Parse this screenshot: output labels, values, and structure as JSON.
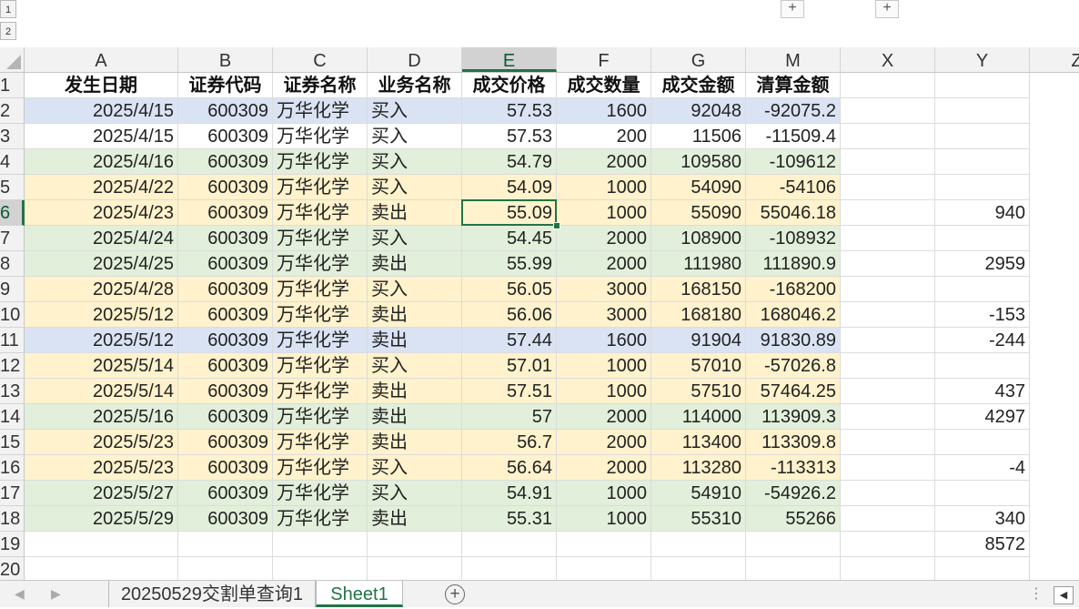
{
  "outline": {
    "levels": [
      "1",
      "2"
    ],
    "plus_symbol": "+"
  },
  "columns": [
    "A",
    "B",
    "C",
    "D",
    "E",
    "F",
    "G",
    "M",
    "X",
    "Y",
    "Z"
  ],
  "selected_column": "E",
  "selected_row": "6",
  "header_row": [
    "发生日期",
    "证券代码",
    "证券名称",
    "业务名称",
    "成交价格",
    "成交数量",
    "成交金额",
    "清算金额"
  ],
  "rows": [
    {
      "num": "1"
    },
    {
      "num": "2",
      "fill": "#dae3f3",
      "cells": [
        "2025/4/15",
        "600309",
        "万华化学",
        "买入",
        "57.53",
        "1600",
        "92048",
        "-92075.2"
      ],
      "x": "",
      "y": ""
    },
    {
      "num": "3",
      "fill": "#ffffff",
      "cells": [
        "2025/4/15",
        "600309",
        "万华化学",
        "买入",
        "57.53",
        "200",
        "11506",
        "-11509.4"
      ],
      "x": "",
      "y": ""
    },
    {
      "num": "4",
      "fill": "#e2efda",
      "cells": [
        "2025/4/16",
        "600309",
        "万华化学",
        "买入",
        "54.79",
        "2000",
        "109580",
        "-109612"
      ],
      "x": "",
      "y": ""
    },
    {
      "num": "5",
      "fill": "#fff2cc",
      "cells": [
        "2025/4/22",
        "600309",
        "万华化学",
        "买入",
        "54.09",
        "1000",
        "54090",
        "-54106"
      ],
      "x": "",
      "y": ""
    },
    {
      "num": "6",
      "fill": "#fff2cc",
      "cells": [
        "2025/4/23",
        "600309",
        "万华化学",
        "卖出",
        "55.09",
        "1000",
        "55090",
        "55046.18"
      ],
      "x": "",
      "y": "940"
    },
    {
      "num": "7",
      "fill": "#e2efda",
      "cells": [
        "2025/4/24",
        "600309",
        "万华化学",
        "买入",
        "54.45",
        "2000",
        "108900",
        "-108932"
      ],
      "x": "",
      "y": ""
    },
    {
      "num": "8",
      "fill": "#e2efda",
      "cells": [
        "2025/4/25",
        "600309",
        "万华化学",
        "卖出",
        "55.99",
        "2000",
        "111980",
        "111890.9"
      ],
      "x": "",
      "y": "2959"
    },
    {
      "num": "9",
      "fill": "#fff2cc",
      "cells": [
        "2025/4/28",
        "600309",
        "万华化学",
        "买入",
        "56.05",
        "3000",
        "168150",
        "-168200"
      ],
      "x": "",
      "y": ""
    },
    {
      "num": "10",
      "fill": "#fff2cc",
      "cells": [
        "2025/5/12",
        "600309",
        "万华化学",
        "卖出",
        "56.06",
        "3000",
        "168180",
        "168046.2"
      ],
      "x": "",
      "y": "-153"
    },
    {
      "num": "11",
      "fill": "#dae3f3",
      "cells": [
        "2025/5/12",
        "600309",
        "万华化学",
        "卖出",
        "57.44",
        "1600",
        "91904",
        "91830.89"
      ],
      "x": "",
      "y": "-244"
    },
    {
      "num": "12",
      "fill": "#fff2cc",
      "cells": [
        "2025/5/14",
        "600309",
        "万华化学",
        "买入",
        "57.01",
        "1000",
        "57010",
        "-57026.8"
      ],
      "x": "",
      "y": ""
    },
    {
      "num": "13",
      "fill": "#fff2cc",
      "cells": [
        "2025/5/14",
        "600309",
        "万华化学",
        "卖出",
        "57.51",
        "1000",
        "57510",
        "57464.25"
      ],
      "x": "",
      "y": "437"
    },
    {
      "num": "14",
      "fill": "#e2efda",
      "cells": [
        "2025/5/16",
        "600309",
        "万华化学",
        "卖出",
        "57",
        "2000",
        "114000",
        "113909.3"
      ],
      "x": "",
      "y": "4297"
    },
    {
      "num": "15",
      "fill": "#fff2cc",
      "cells": [
        "2025/5/23",
        "600309",
        "万华化学",
        "卖出",
        "56.7",
        "2000",
        "113400",
        "113309.8"
      ],
      "x": "",
      "y": ""
    },
    {
      "num": "16",
      "fill": "#fff2cc",
      "cells": [
        "2025/5/23",
        "600309",
        "万华化学",
        "买入",
        "56.64",
        "2000",
        "113280",
        "-113313"
      ],
      "x": "",
      "y": "-4"
    },
    {
      "num": "17",
      "fill": "#e2efda",
      "cells": [
        "2025/5/27",
        "600309",
        "万华化学",
        "买入",
        "54.91",
        "1000",
        "54910",
        "-54926.2"
      ],
      "x": "",
      "y": ""
    },
    {
      "num": "18",
      "fill": "#e2efda",
      "cells": [
        "2025/5/29",
        "600309",
        "万华化学",
        "卖出",
        "55.31",
        "1000",
        "55310",
        "55266"
      ],
      "x": "",
      "y": "340"
    },
    {
      "num": "19",
      "fill": "#ffffff",
      "cells": [
        "",
        "",
        "",
        "",
        "",
        "",
        "",
        ""
      ],
      "x": "",
      "y": "8572"
    },
    {
      "num": "20",
      "fill": "#ffffff",
      "cells": [
        "",
        "",
        "",
        "",
        "",
        "",
        "",
        ""
      ],
      "x": "",
      "y": ""
    }
  ],
  "tabs": {
    "sheets": [
      {
        "label": "20250529交割单查询1",
        "active": false
      },
      {
        "label": "Sheet1",
        "active": true
      }
    ],
    "add_symbol": "+",
    "dots": "⋮",
    "scroll_left": "◀",
    "nav_prev": "◀",
    "nav_next": "▶"
  },
  "colors": {
    "accent": "#217346"
  }
}
